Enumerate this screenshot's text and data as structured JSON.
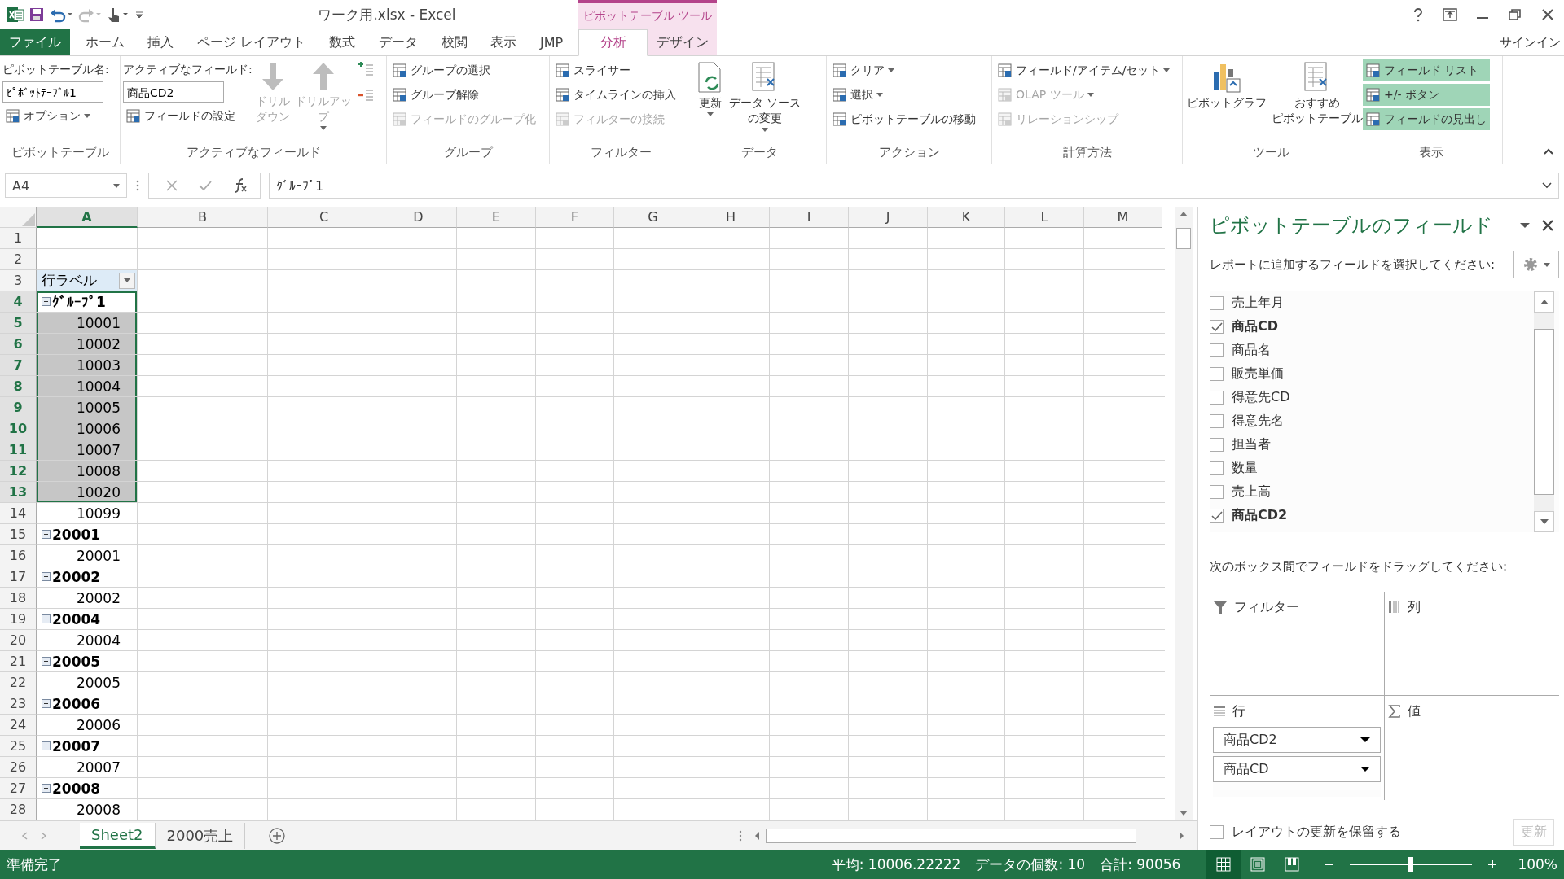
{
  "title_bar": {
    "title": "ワーク用.xlsx - Excel",
    "context_label": "ピボットテーブル ツール"
  },
  "tabs": [
    {
      "label": "ファイル",
      "kind": "file",
      "selected": false
    },
    {
      "label": "ホーム",
      "kind": "normal",
      "selected": false
    },
    {
      "label": "挿入",
      "kind": "normal",
      "selected": false
    },
    {
      "label": "ページ レイアウト",
      "kind": "normal",
      "selected": false
    },
    {
      "label": "数式",
      "kind": "normal",
      "selected": false
    },
    {
      "label": "データ",
      "kind": "normal",
      "selected": false
    },
    {
      "label": "校閲",
      "kind": "normal",
      "selected": false
    },
    {
      "label": "表示",
      "kind": "normal",
      "selected": false
    },
    {
      "label": "JMP",
      "kind": "normal",
      "selected": false
    },
    {
      "label": "分析",
      "kind": "context",
      "selected": true
    },
    {
      "label": "デザイン",
      "kind": "context",
      "selected": false
    }
  ],
  "sign_in": "サインイン",
  "ribbon": {
    "groups": [
      {
        "label": "ピボットテーブル",
        "columns": [
          [
            {
              "kind": "caption",
              "text": "ピボットテーブル名:"
            },
            {
              "kind": "field",
              "text": "ﾋﾟﾎﾞｯﾄﾃｰﾌﾞﾙ1"
            },
            {
              "kind": "small",
              "text": "オプション",
              "dropdown": true,
              "disabled": false
            }
          ]
        ]
      },
      {
        "label": "アクティブなフィールド",
        "columns": [
          [
            {
              "kind": "caption",
              "text": "アクティブなフィールド:"
            },
            {
              "kind": "field",
              "text": "商品CD2"
            },
            {
              "kind": "small",
              "text": "フィールドの設定",
              "dropdown": false,
              "disabled": false
            }
          ],
          [
            {
              "kind": "drill-down",
              "lines": [
                "ドリル",
                "ダウン"
              ],
              "dropdown": false,
              "disabled": true
            }
          ],
          [
            {
              "kind": "drill-up",
              "lines": [
                "ドリルアッ",
                "プ"
              ],
              "dropdown": true,
              "disabled": true
            }
          ],
          [
            {
              "kind": "expand",
              "disabled": false
            },
            {
              "kind": "collapse",
              "disabled": false
            }
          ]
        ]
      },
      {
        "label": "グループ",
        "columns": [
          [
            {
              "kind": "small",
              "text": "グループの選択",
              "dropdown": false,
              "disabled": false
            },
            {
              "kind": "small",
              "text": "グループ解除",
              "dropdown": false,
              "disabled": false
            },
            {
              "kind": "small",
              "text": "フィールドのグループ化",
              "dropdown": false,
              "disabled": true
            }
          ]
        ]
      },
      {
        "label": "フィルター",
        "columns": [
          [
            {
              "kind": "small",
              "text": "スライサー",
              "dropdown": false,
              "disabled": false
            },
            {
              "kind": "small",
              "text": "タイムラインの挿入",
              "dropdown": false,
              "disabled": false
            },
            {
              "kind": "small",
              "text": "フィルターの接続",
              "dropdown": false,
              "disabled": true
            }
          ]
        ]
      },
      {
        "label": "データ",
        "columns": [
          [
            {
              "kind": "large-refresh",
              "lines": [
                "更新"
              ],
              "dropdown": true,
              "disabled": false
            }
          ],
          [
            {
              "kind": "large",
              "lines": [
                "データ ソース",
                "の変更"
              ],
              "dropdown": true,
              "disabled": false
            }
          ]
        ]
      },
      {
        "label": "アクション",
        "columns": [
          [
            {
              "kind": "small",
              "text": "クリア",
              "dropdown": true,
              "disabled": false
            },
            {
              "kind": "small",
              "text": "選択",
              "dropdown": true,
              "disabled": false
            },
            {
              "kind": "small",
              "text": "ピボットテーブルの移動",
              "dropdown": false,
              "disabled": false
            }
          ]
        ]
      },
      {
        "label": "計算方法",
        "columns": [
          [
            {
              "kind": "small",
              "text": "フィールド/アイテム/セット",
              "dropdown": true,
              "disabled": false
            },
            {
              "kind": "small",
              "text": "OLAP ツール",
              "dropdown": true,
              "disabled": true
            },
            {
              "kind": "small",
              "text": "リレーションシップ",
              "dropdown": false,
              "disabled": true
            }
          ]
        ]
      },
      {
        "label": "ツール",
        "columns": [
          [
            {
              "kind": "large-chart",
              "lines": [
                "ピボットグラフ"
              ],
              "dropdown": false,
              "disabled": false
            }
          ],
          [
            {
              "kind": "large",
              "lines": [
                "おすすめ",
                "ピボットテーブル"
              ],
              "dropdown": false,
              "disabled": false
            }
          ]
        ]
      },
      {
        "label": "表示",
        "columns": [
          [
            {
              "kind": "small",
              "text": "フィールド リスト",
              "dropdown": false,
              "disabled": false,
              "on": true
            },
            {
              "kind": "small",
              "text": "+/- ボタン",
              "dropdown": false,
              "disabled": false,
              "on": true
            },
            {
              "kind": "small",
              "text": "フィールドの見出し",
              "dropdown": false,
              "disabled": false,
              "on": true
            }
          ]
        ]
      }
    ]
  },
  "formula_bar": {
    "name_box": "A4",
    "formula": "ｸﾞﾙｰﾌﾟ1"
  },
  "columns": [
    {
      "label": "A",
      "selected": true
    },
    {
      "label": "B",
      "selected": false
    },
    {
      "label": "C",
      "selected": false
    },
    {
      "label": "D",
      "selected": false
    },
    {
      "label": "E",
      "selected": false
    },
    {
      "label": "F",
      "selected": false
    },
    {
      "label": "G",
      "selected": false
    },
    {
      "label": "H",
      "selected": false
    },
    {
      "label": "I",
      "selected": false
    },
    {
      "label": "J",
      "selected": false
    },
    {
      "label": "K",
      "selected": false
    },
    {
      "label": "L",
      "selected": false
    },
    {
      "label": "M",
      "selected": false
    }
  ],
  "rows": [
    {
      "num": "1",
      "selected": false,
      "active": false
    },
    {
      "num": "2",
      "selected": false,
      "active": false
    },
    {
      "num": "3",
      "selected": false,
      "active": false,
      "cell": {
        "kind": "header",
        "text": "行ラベル"
      }
    },
    {
      "num": "4",
      "selected": true,
      "active": true,
      "cell": {
        "kind": "group",
        "text": "ｸﾞﾙｰﾌﾟ1"
      }
    },
    {
      "num": "5",
      "selected": true,
      "active": false,
      "cell": {
        "kind": "item",
        "text": "10001"
      }
    },
    {
      "num": "6",
      "selected": true,
      "active": false,
      "cell": {
        "kind": "item",
        "text": "10002"
      }
    },
    {
      "num": "7",
      "selected": true,
      "active": false,
      "cell": {
        "kind": "item",
        "text": "10003"
      }
    },
    {
      "num": "8",
      "selected": true,
      "active": false,
      "cell": {
        "kind": "item",
        "text": "10004"
      }
    },
    {
      "num": "9",
      "selected": true,
      "active": false,
      "cell": {
        "kind": "item",
        "text": "10005"
      }
    },
    {
      "num": "10",
      "selected": true,
      "active": false,
      "cell": {
        "kind": "item",
        "text": "10006"
      }
    },
    {
      "num": "11",
      "selected": true,
      "active": false,
      "cell": {
        "kind": "item",
        "text": "10007"
      }
    },
    {
      "num": "12",
      "selected": true,
      "active": false,
      "cell": {
        "kind": "item",
        "text": "10008"
      }
    },
    {
      "num": "13",
      "selected": true,
      "active": false,
      "cell": {
        "kind": "item",
        "text": "10020"
      }
    },
    {
      "num": "14",
      "selected": false,
      "active": false,
      "cell": {
        "kind": "item",
        "text": "10099"
      }
    },
    {
      "num": "15",
      "selected": false,
      "active": false,
      "cell": {
        "kind": "group",
        "text": "20001"
      }
    },
    {
      "num": "16",
      "selected": false,
      "active": false,
      "cell": {
        "kind": "item",
        "text": "20001"
      }
    },
    {
      "num": "17",
      "selected": false,
      "active": false,
      "cell": {
        "kind": "group",
        "text": "20002"
      }
    },
    {
      "num": "18",
      "selected": false,
      "active": false,
      "cell": {
        "kind": "item",
        "text": "20002"
      }
    },
    {
      "num": "19",
      "selected": false,
      "active": false,
      "cell": {
        "kind": "group",
        "text": "20004"
      }
    },
    {
      "num": "20",
      "selected": false,
      "active": false,
      "cell": {
        "kind": "item",
        "text": "20004"
      }
    },
    {
      "num": "21",
      "selected": false,
      "active": false,
      "cell": {
        "kind": "group",
        "text": "20005"
      }
    },
    {
      "num": "22",
      "selected": false,
      "active": false,
      "cell": {
        "kind": "item",
        "text": "20005"
      }
    },
    {
      "num": "23",
      "selected": false,
      "active": false,
      "cell": {
        "kind": "group",
        "text": "20006"
      }
    },
    {
      "num": "24",
      "selected": false,
      "active": false,
      "cell": {
        "kind": "item",
        "text": "20006"
      }
    },
    {
      "num": "25",
      "selected": false,
      "active": false,
      "cell": {
        "kind": "group",
        "text": "20007"
      }
    },
    {
      "num": "26",
      "selected": false,
      "active": false,
      "cell": {
        "kind": "item",
        "text": "20007"
      }
    },
    {
      "num": "27",
      "selected": false,
      "active": false,
      "cell": {
        "kind": "group",
        "text": "20008"
      }
    },
    {
      "num": "28",
      "selected": false,
      "active": false,
      "cell": {
        "kind": "item",
        "text": "20008"
      }
    }
  ],
  "sheet_tabs": [
    {
      "label": "Sheet2",
      "selected": true
    },
    {
      "label": "2000売上",
      "selected": false
    }
  ],
  "pane": {
    "title": "ピボットテーブルのフィールド",
    "prompt": "レポートに追加するフィールドを選択してください:",
    "fields": [
      {
        "label": "売上年月",
        "checked": false
      },
      {
        "label": "商品CD",
        "checked": true
      },
      {
        "label": "商品名",
        "checked": false
      },
      {
        "label": "販売単価",
        "checked": false
      },
      {
        "label": "得意先CD",
        "checked": false
      },
      {
        "label": "得意先名",
        "checked": false
      },
      {
        "label": "担当者",
        "checked": false
      },
      {
        "label": "数量",
        "checked": false
      },
      {
        "label": "売上高",
        "checked": false
      },
      {
        "label": "商品CD2",
        "checked": true
      }
    ],
    "drag_prompt": "次のボックス間でフィールドをドラッグしてください:",
    "areas": [
      {
        "kind": "filter",
        "label": "フィルター"
      },
      {
        "kind": "columns",
        "label": "列"
      },
      {
        "kind": "rows",
        "label": "行",
        "items": [
          "商品CD2",
          "商品CD"
        ]
      },
      {
        "kind": "values",
        "label": "値"
      }
    ],
    "defer": {
      "label": "レイアウトの更新を保留する",
      "checked": false
    },
    "update_button": {
      "label": "更新",
      "disabled": true
    }
  },
  "status_bar": {
    "status": "準備完了",
    "stats": [
      "平均: 10006.22222",
      "データの個数: 10",
      "合計: 90056"
    ],
    "views": [
      {
        "kind": "normal",
        "selected": true
      },
      {
        "kind": "layout",
        "selected": false
      },
      {
        "kind": "break",
        "selected": false
      }
    ],
    "zoom": {
      "level": 0.5,
      "label": "100%"
    }
  }
}
